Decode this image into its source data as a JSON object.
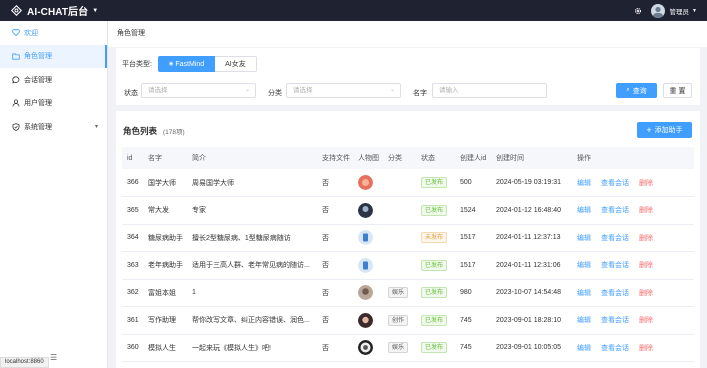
{
  "header": {
    "app_title": "AI-CHAT后台",
    "user_name": "管理员"
  },
  "sidebar": {
    "items": [
      {
        "label": "欢迎",
        "icon": "heart-icon"
      },
      {
        "label": "角色管理",
        "icon": "folder-icon"
      },
      {
        "label": "会话管理",
        "icon": "chat-icon"
      },
      {
        "label": "用户管理",
        "icon": "user-icon"
      },
      {
        "label": "系统管理",
        "icon": "shield-icon"
      }
    ],
    "status_url": "localhost:8860"
  },
  "page": {
    "title": "角色管理"
  },
  "filters": {
    "platform_label": "平台类型:",
    "platform_tabs": [
      "FastMind",
      "AI女友"
    ],
    "status_label": "状态",
    "status_placeholder": "请选择",
    "category_label": "分类",
    "category_placeholder": "请选择",
    "name_label": "名字",
    "name_placeholder": "请输入",
    "search_button": "查询",
    "reset_button": "重 置"
  },
  "list": {
    "title": "角色列表",
    "count": "(178项)",
    "add_button": "添加助手",
    "columns": [
      "id",
      "名字",
      "简介",
      "支持文件",
      "人物图",
      "分类",
      "状态",
      "创建人id",
      "创建时间",
      "操作"
    ],
    "ops": {
      "edit": "编辑",
      "view": "查看会话",
      "delete": "删除"
    },
    "rows": [
      {
        "id": "366",
        "name": "国学大师",
        "intro": "周易国学大师",
        "file": "否",
        "category": "",
        "status": "已发布",
        "creator": "500",
        "time": "2024-05-19 03:19:31"
      },
      {
        "id": "365",
        "name": "常大发",
        "intro": "专家",
        "file": "否",
        "category": "",
        "status": "已发布",
        "creator": "1524",
        "time": "2024-01-12 16:48:40"
      },
      {
        "id": "364",
        "name": "糖尿病助手",
        "intro": "擅长2型糖尿病、1型糖尿病随访",
        "file": "否",
        "category": "",
        "status": "未发布",
        "creator": "1517",
        "time": "2024-01-11 12:37:13"
      },
      {
        "id": "363",
        "name": "老年病助手",
        "intro": "适用于三高人群、老年常见病的随访...",
        "file": "否",
        "category": "",
        "status": "已发布",
        "creator": "1517",
        "time": "2024-01-11 12:31:06"
      },
      {
        "id": "362",
        "name": "富姐本姐",
        "intro": "1",
        "file": "否",
        "category": "娱乐",
        "status": "已发布",
        "creator": "980",
        "time": "2023-10-07 14:54:48"
      },
      {
        "id": "361",
        "name": "写作助理",
        "intro": "帮你改写文章、纠正内容错误、润色...",
        "file": "否",
        "category": "创作",
        "status": "已发布",
        "creator": "745",
        "time": "2023-09-01 18:28:10"
      },
      {
        "id": "360",
        "name": "模拟人生",
        "intro": "一起来玩《模拟人生》吧!",
        "file": "否",
        "category": "娱乐",
        "status": "已发布",
        "creator": "745",
        "time": "2023-09-01 10:05:05"
      }
    ]
  }
}
